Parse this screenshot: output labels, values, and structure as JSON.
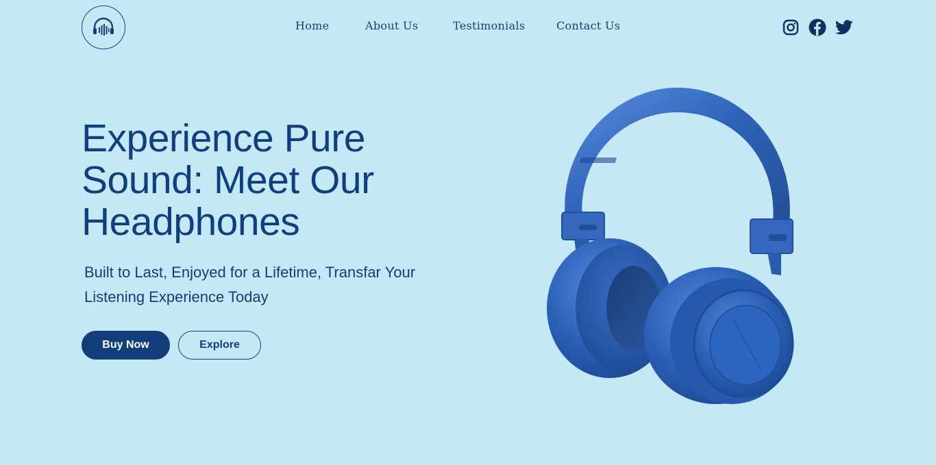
{
  "header": {
    "logo_icon": "headphones-soundwave-icon",
    "nav": [
      {
        "label": "Home"
      },
      {
        "label": "About Us"
      },
      {
        "label": "Testimonials"
      },
      {
        "label": "Contact Us"
      }
    ],
    "social": [
      "instagram-icon",
      "facebook-icon",
      "twitter-icon"
    ]
  },
  "hero": {
    "title": "Experience Pure Sound: Meet Our Headphones",
    "subtitle": "Built to Last, Enjoyed for a Lifetime, Transfar Your Listening Experience Today",
    "buy_label": "Buy Now",
    "explore_label": "Explore",
    "image_icon": "headphones-image"
  },
  "colors": {
    "background": "#c5e8f5",
    "primary": "#123f7b",
    "product": "#2f6cc4"
  }
}
